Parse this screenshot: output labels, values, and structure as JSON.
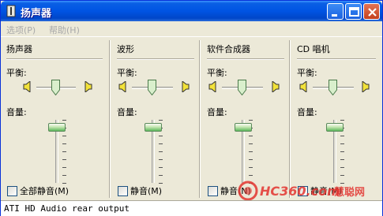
{
  "window": {
    "title": "扬声器"
  },
  "menu": [
    {
      "label": "选项(P)"
    },
    {
      "label": "帮助(H)"
    }
  ],
  "labels": {
    "balance": "平衡:",
    "volume": "音量:"
  },
  "channels": [
    {
      "name": "扬声器",
      "mute_label": "全部静音(M)",
      "muted": false,
      "volume": 0.95,
      "balance": 0.5
    },
    {
      "name": "波形",
      "mute_label": "静音(M)",
      "muted": false,
      "volume": 0.95,
      "balance": 0.5
    },
    {
      "name": "软件合成器",
      "mute_label": "静音(N)",
      "muted": false,
      "volume": 0.95,
      "balance": 0.5
    },
    {
      "name": "CD 唱机",
      "mute_label": "静音(M)",
      "muted": false,
      "volume": 0.95,
      "balance": 0.5
    }
  ],
  "status": {
    "text": "ATI HD Audio rear output"
  },
  "watermark": {
    "text": "HC360.com 慧聪网"
  },
  "colors": {
    "title_bar": "#0054e3",
    "window_bg": "#ece9d8",
    "thumb_green": "#5cb85c"
  }
}
